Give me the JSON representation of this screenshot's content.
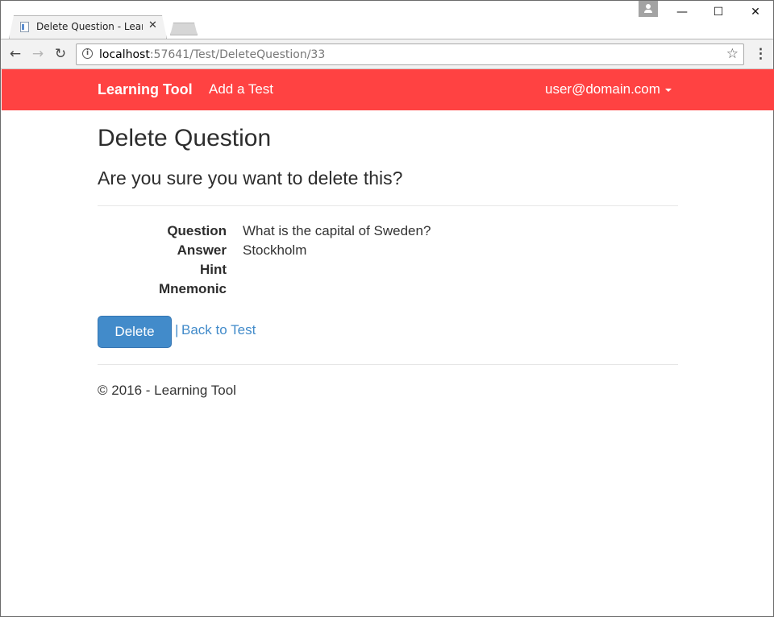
{
  "browser": {
    "tab_title": "Delete Question - Learning Tool",
    "close_glyph": "✕",
    "url_host": "localhost",
    "url_path": ":57641/Test/DeleteQuestion/33",
    "minimize_glyph": "—",
    "maximize_glyph": "☐",
    "close_window_glyph": "✕",
    "back_glyph": "←",
    "forward_glyph": "→",
    "reload_glyph": "↻",
    "star_glyph": "☆",
    "menu_glyph": "⋮",
    "info_glyph": "i"
  },
  "navbar": {
    "brand": "Learning Tool",
    "links": [
      "Add a Test"
    ],
    "user": "user@domain.com",
    "color": "#ff4242"
  },
  "page": {
    "title": "Delete Question",
    "confirm": "Are you sure you want to delete this?",
    "fields": [
      {
        "label": "Question",
        "value": "What is the capital of Sweden?"
      },
      {
        "label": "Answer",
        "value": "Stockholm"
      },
      {
        "label": "Hint",
        "value": ""
      },
      {
        "label": "Mnemonic",
        "value": ""
      }
    ],
    "delete_label": "Delete",
    "separator": "|",
    "back_label": "Back to Test",
    "footer": "© 2016 - Learning Tool"
  },
  "colors": {
    "primary_button": "#428bca",
    "link": "#428bca"
  },
  "icons": [
    "page-favicon-icon",
    "close-tab-icon",
    "profile-icon",
    "back-arrow-icon",
    "forward-arrow-icon",
    "reload-icon",
    "info-icon",
    "star-icon",
    "menu-icon",
    "caret-down-icon"
  ]
}
